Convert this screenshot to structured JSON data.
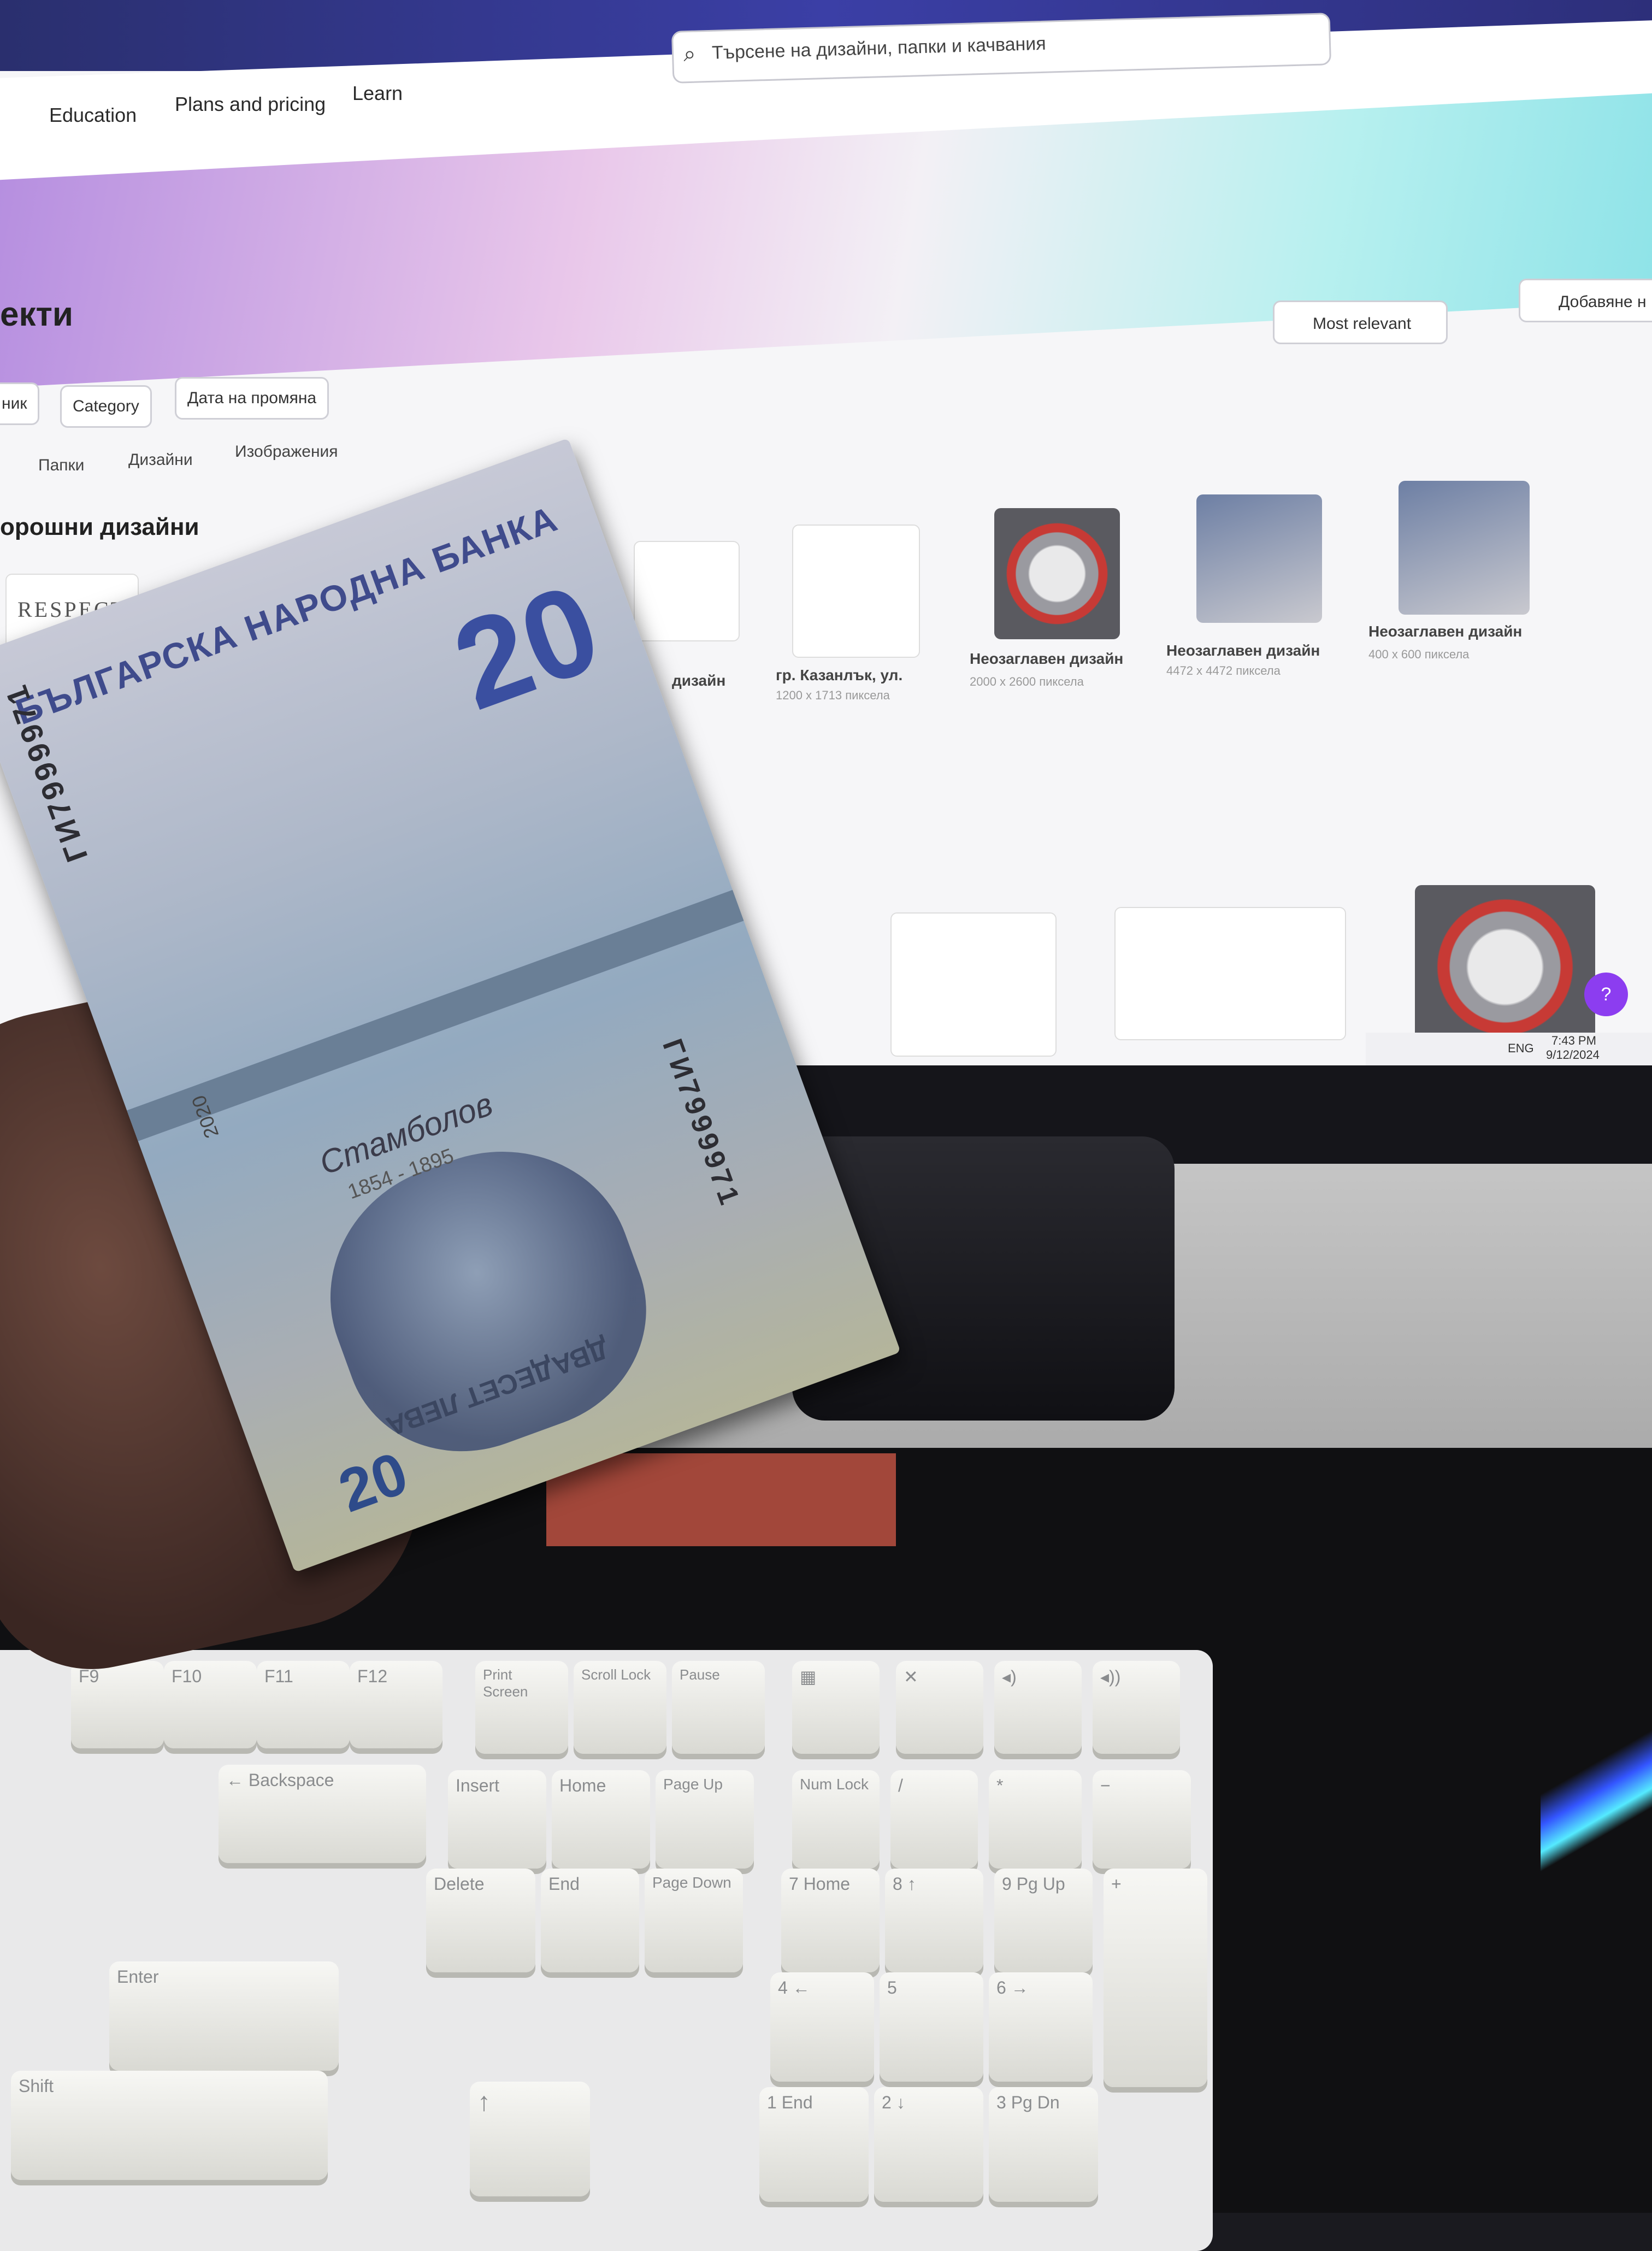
{
  "screen": {
    "search": {
      "placeholder": "Търсене на дизайни, папки и качвания"
    },
    "nav": [
      "Education",
      "Plans and pricing",
      "Learn"
    ],
    "page_title": "екти",
    "sort_button": "Most relevant",
    "add_button": "Добавяне н",
    "filters": [
      "ник",
      "Category",
      "Дата на промяна"
    ],
    "tabs": [
      "Папки",
      "Дизайни",
      "Изображения"
    ],
    "section_title": "орошни дизайни",
    "respect_label": "RESPECT",
    "cards": [
      {
        "title": "дизайн",
        "sub": ""
      },
      {
        "title": "гр. Казанлък, ул.",
        "sub": "1200 x 1713 пиксела"
      },
      {
        "title": "Неозаглавен дизайн",
        "sub": "2000 x 2600 пиксела"
      },
      {
        "title": "Неозаглавен дизайн",
        "sub": "4472 x 4472 пиксела"
      },
      {
        "title": "Неозаглавен дизайн",
        "sub": "400 x 600 пиксела"
      }
    ],
    "help": "?",
    "taskbar": {
      "lang": "ENG",
      "time": "7:43 PM",
      "date": "9/12/2024"
    }
  },
  "banknote": {
    "bank": "БЪЛГАРСКА НАРОДНА БАНКА",
    "denomination": "20",
    "serial": "ГИ7999971",
    "serial_right": "ГИ7999971",
    "year": "2020",
    "portrait_name": "Стамболов",
    "dates": "1854 - 1895",
    "words": "ДВАДЕСЕТ ЛЕВА"
  },
  "keyboard": {
    "fn_row": [
      "F9",
      "F10",
      "F11",
      "F12",
      "Print Screen",
      "Scroll Lock",
      "Pause"
    ],
    "nav_keys": [
      "Insert",
      "Home",
      "Page Up",
      "Delete",
      "End",
      "Page Down"
    ],
    "numpad": [
      "Num Lock",
      "/",
      "*",
      "−",
      "7 Home",
      "8 ↑",
      "9 Pg Up",
      "+",
      "4 ←",
      "5",
      "6 →",
      "1 End",
      "2 ↓",
      "3 Pg Dn"
    ],
    "main": [
      "← Backspace",
      "Enter",
      "Shift",
      "↑"
    ]
  }
}
